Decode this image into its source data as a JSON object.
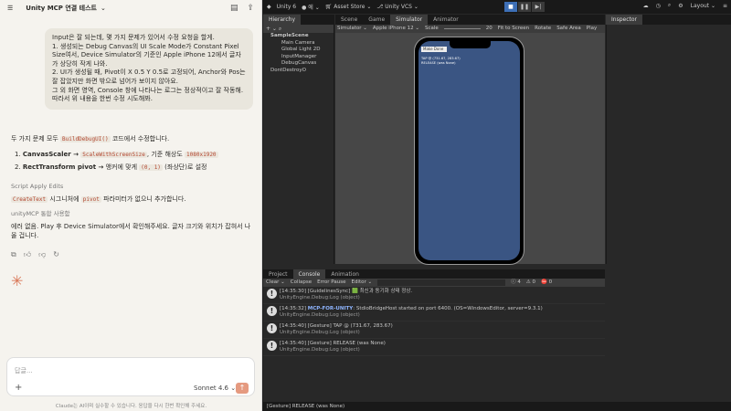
{
  "chat": {
    "title": "Unity MCP 연결 테스트",
    "user_message": [
      "Input은 잘 되는데, 몇 가지 문제가 있어서 수정 요청을 할게.",
      "1. 생성되는 Debug Canvas의 UI Scale Mode가 Constant Pixel Size여서, Device Simulator의 기준인 Apple iPhone 12에서 글자가 상당히 작게 나와.",
      "2. UI가 생성될 때, Pivot이 X 0.5 Y 0.5로 고정되어, Anchor와 Pos는 잘 잡았지만 화면 밖으로 넘어가 보이지 않아요.",
      "그 외 화면 영역, Console 창에 나타나는 로그는 정상적이고 잘 작동해. 따라서 위 내용을 한번 수정 시도해봐."
    ],
    "intro": [
      "두 가지 문제 모두",
      "BuildDebugUI()",
      "코드에서 수정합니다."
    ],
    "item1": [
      "CanvasScaler →",
      "ScaleWithScreenSize",
      ", 기준 해상도",
      "1080x1920"
    ],
    "item2": [
      "RectTransform pivot →",
      "앵커에 맞게",
      "(0, 1)",
      "(좌상단)로 설정"
    ],
    "tool1": "Script Apply Edits",
    "note1": [
      "CreateText",
      "시그니처에",
      "pivot",
      "파라미터가 없으니 추가합니다."
    ],
    "tool2": "unityMCP 통합 사용함",
    "final": "에러 없음. Play 후 Device Simulator에서 확인해주세요. 글자 크기와 위치가 잡혀서 나올 겁니다.",
    "input_placeholder": "답글...",
    "model": "Sonnet 4.6",
    "disclaimer": "Claude는 AI이며 실수할 수 있습니다. 응답을 다시 한번 확인해 주세요."
  },
  "unity": {
    "toolbar": {
      "project": "Unity 6",
      "account": "에",
      "store": "Asset Store",
      "vcs": "Unity VCS",
      "layout": "Layout"
    },
    "tabs": {
      "hierarchy": "Hierarchy",
      "scene": "Scene",
      "game": "Game",
      "simulator": "Simulator",
      "animator": "Animator",
      "inspector": "Inspector",
      "project": "Project",
      "console": "Console",
      "animation": "Animation"
    },
    "hierarchy": [
      "SampleScene",
      "Main Camera",
      "Global Light 2D",
      "InputManager",
      "DebugCanvas",
      "DontDestroyO"
    ],
    "sim": {
      "mode": "Simulator",
      "device": "Apple iPhone 12",
      "scale_label": "Scale",
      "scale": "20",
      "fit": "Fit to Screen",
      "rotate": "Rotate",
      "safe": "Safe Area",
      "play": "Play"
    },
    "phone": {
      "button": "Make Done",
      "line1": "TAP @ (731.67, 283.67)",
      "line2": "RELEASE (was None)"
    },
    "console_tools": {
      "clear": "Clear",
      "collapse": "Collapse",
      "error_pause": "Error Pause",
      "editor": "Editor",
      "info": "4",
      "warn": "0",
      "err": "0"
    },
    "logs": [
      {
        "time": "[14:35:30]",
        "msg": "[GuidelinesSync] 🟩 최신과 동기화 상태 정상.",
        "sub": "UnityEngine.Debug:Log (object)",
        "link": ""
      },
      {
        "time": "[14:35:32]",
        "link": "MCP-FOR-UNITY",
        "msg": ": StdioBridgeHost started on port 6400. (OS=WindowsEditor, server=9.3.1)",
        "sub": "UnityEngine.Debug:Log (object)"
      },
      {
        "time": "[14:35:40]",
        "msg": "[Gesture] TAP @ (731.67, 283.67)",
        "sub": "UnityEngine.Debug:Log (object)",
        "link": ""
      },
      {
        "time": "[14:35:40]",
        "msg": "[Gesture] RELEASE (was None)",
        "sub": "UnityEngine.Debug:Log (object)",
        "link": ""
      }
    ],
    "status": "[Gesture] RELEASE (was None)"
  }
}
